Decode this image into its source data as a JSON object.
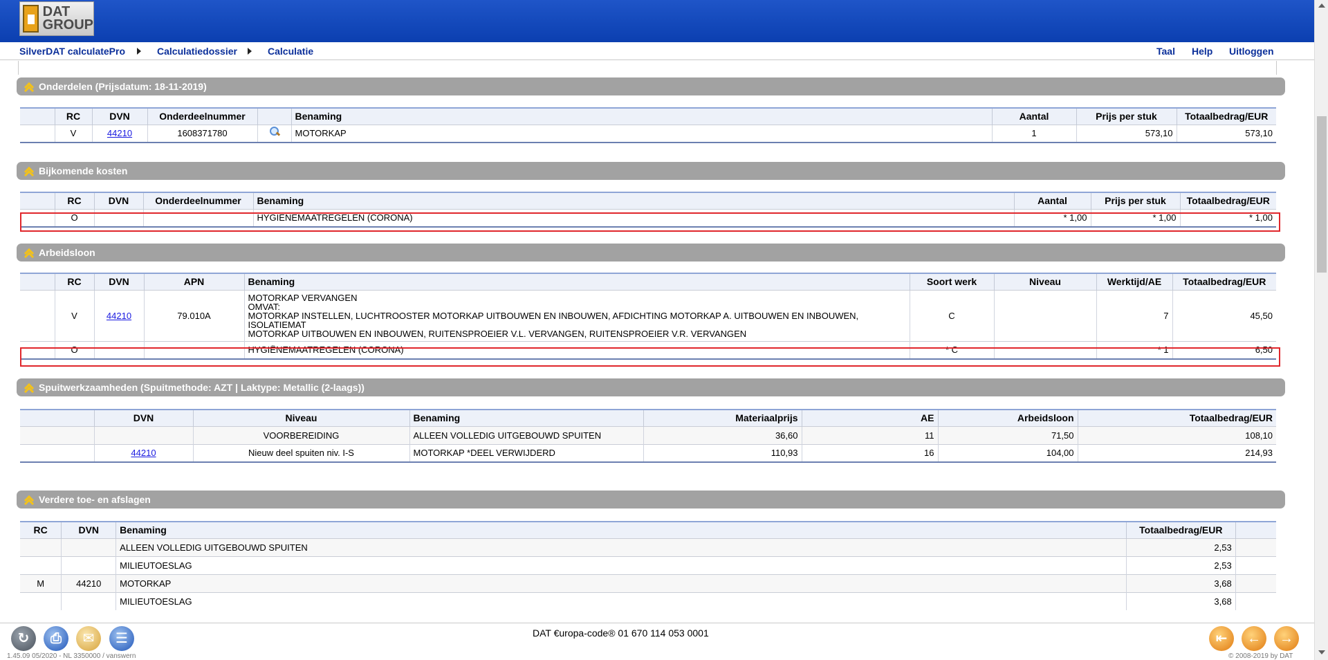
{
  "header": {
    "logo_line1": "DAT",
    "logo_line2": "GROUP",
    "breadcrumb": [
      "SilverDAT calculatePro",
      "Calculatiedossier",
      "Calculatie"
    ],
    "links": {
      "language": "Taal",
      "help": "Help",
      "logout": "Uitloggen"
    }
  },
  "parts": {
    "title": "Onderdelen (Prijsdatum: 18-11-2019)",
    "headers": [
      "RC",
      "DVN",
      "Onderdeelnummer",
      "",
      "Benaming",
      "Aantal",
      "Prijs per stuk",
      "Totaalbedrag/EUR"
    ],
    "rows": [
      {
        "rc": "V",
        "dvn": "44210",
        "part_no": "1608371780",
        "name": "MOTORKAP",
        "qty": "1",
        "unit_price": "573,10",
        "total": "573,10"
      }
    ]
  },
  "additional_costs": {
    "title": "Bijkomende kosten",
    "headers": [
      "",
      "RC",
      "DVN",
      "Onderdeelnummer",
      "Benaming",
      "Aantal",
      "Prijs per stuk",
      "Totaalbedrag/EUR"
    ],
    "rows": [
      {
        "rc": "O",
        "dvn": "",
        "part_no": "",
        "name": "HYGIËNEMAATREGELEN (CORONA)",
        "qty": "* 1,00",
        "unit_price": "* 1,00",
        "total": "* 1,00"
      }
    ]
  },
  "labour": {
    "title": "Arbeidsloon",
    "headers": [
      "",
      "RC",
      "DVN",
      "APN",
      "Benaming",
      "Soort werk",
      "Niveau",
      "Werktijd/AE",
      "Totaalbedrag/EUR"
    ],
    "rows": [
      {
        "rc": "V",
        "dvn": "44210",
        "apn": "79.010A",
        "name_lines": [
          "MOTORKAP VERVANGEN",
          "OMVAT:",
          "MOTORKAP INSTELLEN, LUCHTROOSTER MOTORKAP UITBOUWEN EN INBOUWEN, AFDICHTING MOTORKAP A. UITBOUWEN EN INBOUWEN, ISOLATIEMAT",
          "MOTORKAP UITBOUWEN EN INBOUWEN, RUITENSPROEIER V.L. VERVANGEN, RUITENSPROEIER V.R. VERVANGEN"
        ],
        "work_type": "C",
        "level": "",
        "time": "7",
        "total": "45,50"
      },
      {
        "rc": "O",
        "dvn": "",
        "apn": "",
        "name_lines": [
          "HYGIËNEMAATREGELEN (CORONA)"
        ],
        "work_type": "* C",
        "level": "",
        "time": "* 1",
        "total": "6,50"
      }
    ]
  },
  "painting": {
    "title": "Spuitwerkzaamheden (Spuitmethode: AZT | Laktype: Metallic (2-laags))",
    "headers": [
      "",
      "DVN",
      "Niveau",
      "Benaming",
      "Materiaalprijs",
      "AE",
      "Arbeidsloon",
      "Totaalbedrag/EUR"
    ],
    "rows": [
      {
        "dvn": "",
        "level": "VOORBEREIDING",
        "name": "ALLEEN VOLLEDIG UITGEBOUWD SPUITEN",
        "material": "36,60",
        "ae": "11",
        "labour": "71,50",
        "total": "108,10"
      },
      {
        "dvn": "44210",
        "level": "Nieuw deel spuiten niv. I-S",
        "name": "MOTORKAP *DEEL VERWIJDERD",
        "material": "110,93",
        "ae": "16",
        "labour": "104,00",
        "total": "214,93"
      }
    ]
  },
  "surcharges": {
    "title": "Verdere toe- en afslagen",
    "headers": [
      "RC",
      "DVN",
      "Benaming",
      "Totaalbedrag/EUR",
      ""
    ],
    "rows": [
      {
        "rc": "",
        "dvn": "",
        "name": "ALLEEN VOLLEDIG UITGEBOUWD SPUITEN",
        "total": "2,53"
      },
      {
        "rc": "",
        "dvn": "",
        "name": "MILIEUTOESLAG",
        "total": "2,53"
      },
      {
        "rc": "M",
        "dvn": "44210",
        "name": "MOTORKAP",
        "total": "3,68"
      },
      {
        "rc": "",
        "dvn": "",
        "name": "MILIEUTOESLAG",
        "total": "3,68"
      }
    ]
  },
  "footer": {
    "europa_code": "DAT €uropa-code® 01 670 114 053 0001",
    "version": "1.45.09   05/2020 - NL   3350000 / vanswern",
    "copyright": "© 2008-2019 by DAT",
    "icons": [
      "refresh-icon",
      "print-icon",
      "email-icon",
      "document-icon",
      "first-page-icon",
      "back-icon",
      "forward-icon"
    ]
  }
}
